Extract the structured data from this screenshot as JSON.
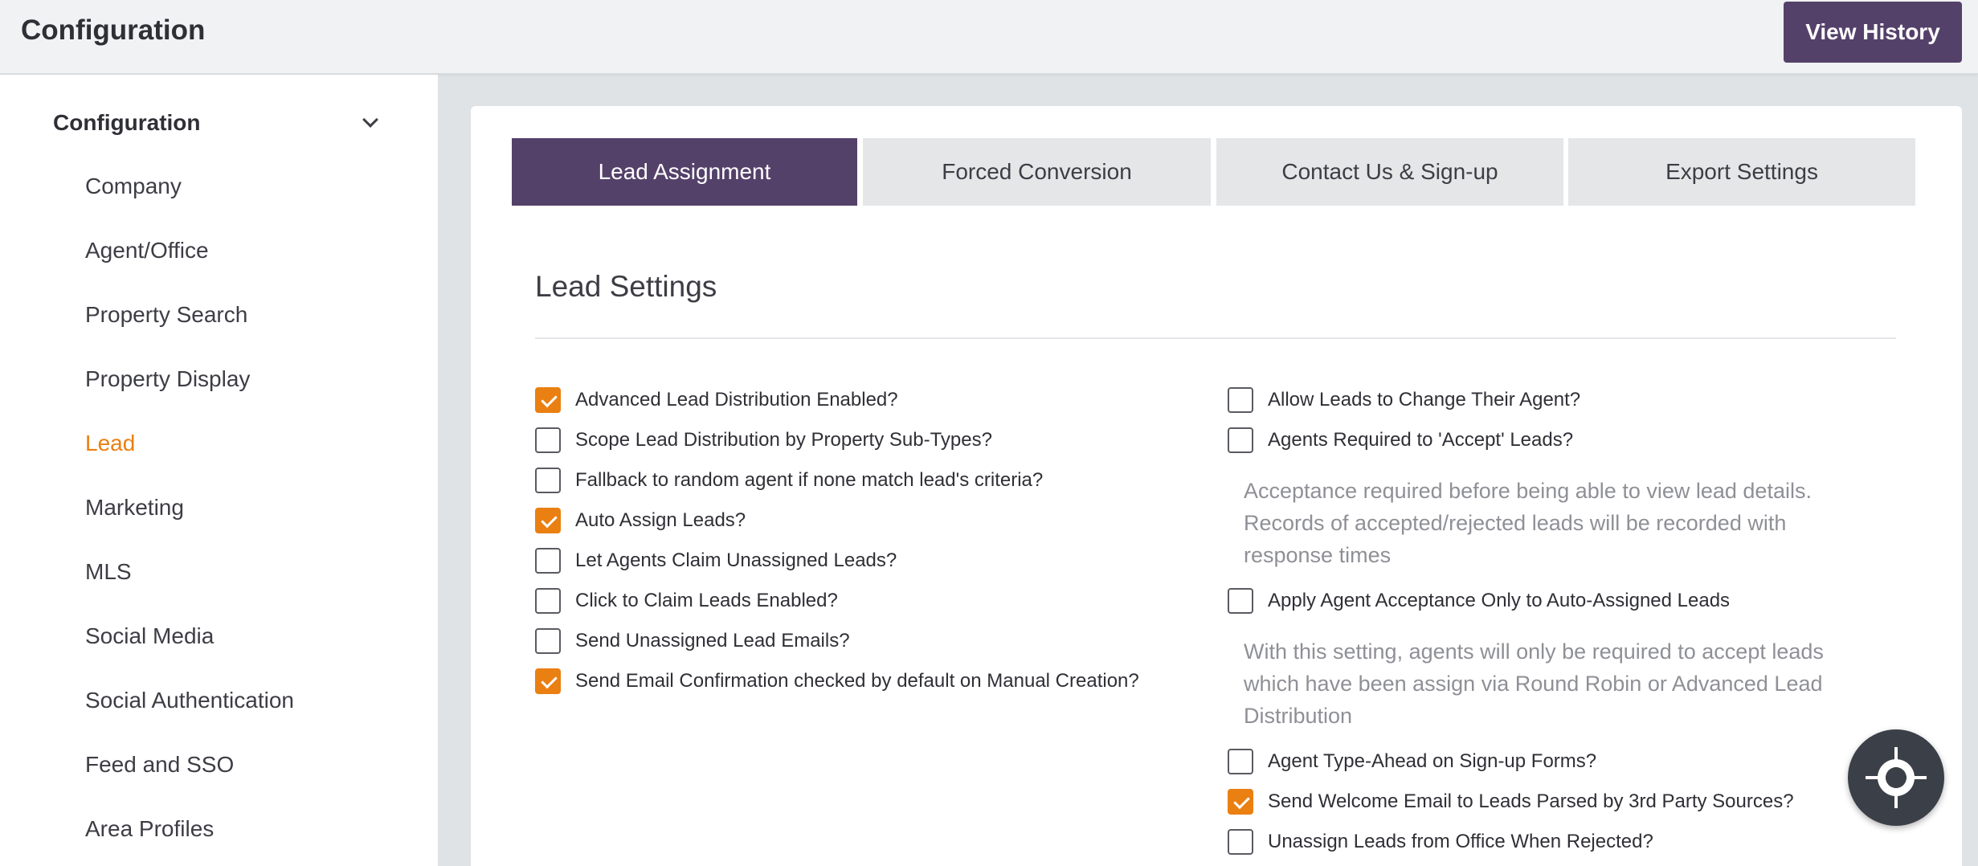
{
  "header": {
    "title": "Configuration",
    "view_history_label": "View History"
  },
  "sidebar": {
    "section_label": "Configuration",
    "items": [
      {
        "label": "Company"
      },
      {
        "label": "Agent/Office"
      },
      {
        "label": "Property Search"
      },
      {
        "label": "Property Display"
      },
      {
        "label": "Lead",
        "active": true
      },
      {
        "label": "Marketing"
      },
      {
        "label": "MLS"
      },
      {
        "label": "Social Media"
      },
      {
        "label": "Social Authentication"
      },
      {
        "label": "Feed and SSO"
      },
      {
        "label": "Area Profiles"
      }
    ]
  },
  "tabs": [
    {
      "label": "Lead Assignment",
      "active": true
    },
    {
      "label": "Forced Conversion"
    },
    {
      "label": "Contact Us & Sign-up"
    },
    {
      "label": "Export Settings"
    }
  ],
  "section": {
    "title": "Lead Settings"
  },
  "left_settings": [
    {
      "label": "Advanced Lead Distribution Enabled?",
      "checked": true
    },
    {
      "label": "Scope Lead Distribution by Property Sub-Types?",
      "checked": false
    },
    {
      "label": "Fallback to random agent if none match lead's criteria?",
      "checked": false
    },
    {
      "label": "Auto Assign Leads?",
      "checked": true
    },
    {
      "label": "Let Agents Claim Unassigned Leads?",
      "checked": false
    },
    {
      "label": "Click to Claim Leads Enabled?",
      "checked": false
    },
    {
      "label": "Send Unassigned Lead Emails?",
      "checked": false
    },
    {
      "label": "Send Email Confirmation checked by default on Manual Creation?",
      "checked": true
    }
  ],
  "right_settings": [
    {
      "label": "Allow Leads to Change Their Agent?",
      "checked": false
    },
    {
      "label": "Agents Required to 'Accept' Leads?",
      "checked": false
    },
    {
      "label": "Apply Agent Acceptance Only to Auto-Assigned Leads",
      "checked": false
    },
    {
      "label": "Agent Type-Ahead on Sign-up Forms?",
      "checked": false
    },
    {
      "label": "Send Welcome Email to Leads Parsed by 3rd Party Sources?",
      "checked": true
    },
    {
      "label": "Unassign Leads from Office When Rejected?",
      "checked": false
    }
  ],
  "help": {
    "acceptance": "Acceptance required before being able to view lead details. Records of accepted/rejected leads will be recorded with response times",
    "auto_assigned": "With this setting, agents will only be required to accept leads which have been assign via Round Robin or Advanced Lead Distribution"
  },
  "colors": {
    "brand_purple": "#54416a",
    "accent_orange": "#ea7f12"
  },
  "icons": {
    "fab": "crosshair-icon"
  }
}
